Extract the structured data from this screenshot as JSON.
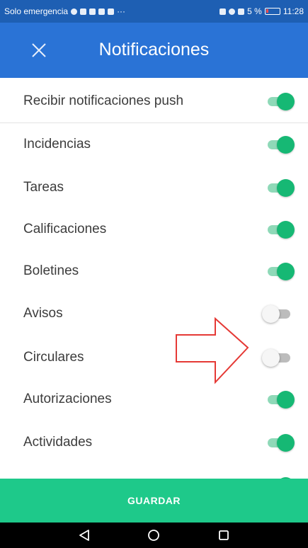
{
  "status_bar": {
    "carrier": "Solo emergencia",
    "battery": "5 %",
    "time": "11:28"
  },
  "header": {
    "close_icon": "close-icon",
    "title": "Notificaciones"
  },
  "master": {
    "label": "Recibir notificaciones push",
    "enabled": true
  },
  "items": [
    {
      "label": "Incidencias",
      "enabled": true
    },
    {
      "label": "Tareas",
      "enabled": true
    },
    {
      "label": "Calificaciones",
      "enabled": true
    },
    {
      "label": "Boletines",
      "enabled": true
    },
    {
      "label": "Avisos",
      "enabled": false
    },
    {
      "label": "Circulares",
      "enabled": false
    },
    {
      "label": "Autorizaciones",
      "enabled": true
    },
    {
      "label": "Actividades",
      "enabled": true
    }
  ],
  "actions": {
    "save_label": "GUARDAR"
  },
  "colors": {
    "status_bar": "#1e5fb3",
    "app_bar": "#2a73d6",
    "toggle_on": "#16b874",
    "save_button": "#1ec98a",
    "annotation_arrow": "#e53935"
  },
  "nav_icons": [
    "back-icon",
    "home-icon",
    "recents-icon"
  ]
}
